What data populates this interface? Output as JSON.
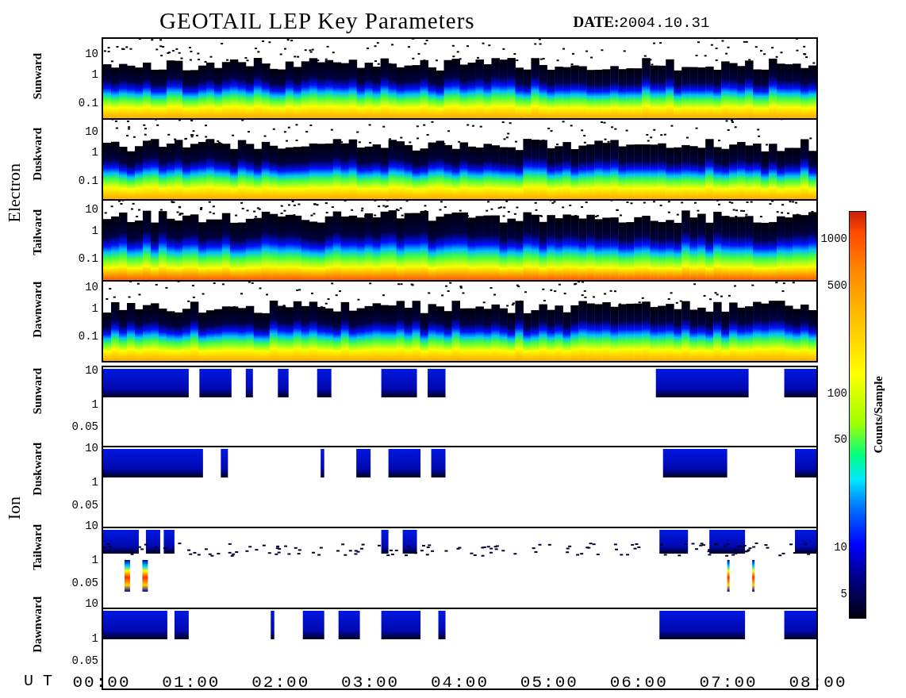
{
  "title": "GEOTAIL LEP Key Parameters",
  "date": {
    "label": "DATE:",
    "value": "2004.10.31"
  },
  "groups": [
    {
      "name": "Electron",
      "kind": "electron",
      "panels": [
        {
          "label": "Sunward",
          "yticks": [
            "10",
            "1",
            "0.1"
          ]
        },
        {
          "label": "Duskward",
          "yticks": [
            "10",
            "1",
            "0.1"
          ]
        },
        {
          "label": "Tailward",
          "yticks": [
            "10",
            "1",
            "0.1"
          ]
        },
        {
          "label": "Dawnward",
          "yticks": [
            "10",
            "1",
            "0.1"
          ]
        }
      ]
    },
    {
      "name": "Ion",
      "kind": "ion",
      "panels": [
        {
          "label": "Sunward",
          "yticks": [
            "10",
            "1",
            "0.05"
          ]
        },
        {
          "label": "Duskward",
          "yticks": [
            "10",
            "1",
            "0.05"
          ]
        },
        {
          "label": "Tailward",
          "yticks": [
            "10",
            "1",
            "0.05"
          ]
        },
        {
          "label": "Dawnward",
          "yticks": [
            "10",
            "1",
            "0.05"
          ]
        }
      ]
    }
  ],
  "colorbar": {
    "label": "Counts/Sample",
    "ticks": [
      "1000",
      "500",
      "100",
      "50",
      "10",
      "5"
    ]
  },
  "time_axis": {
    "label": "U T",
    "ticks": [
      "00:00",
      "01:00",
      "02:00",
      "03:00",
      "04:00",
      "05:00",
      "06:00",
      "07:00",
      "08:00"
    ]
  }
}
